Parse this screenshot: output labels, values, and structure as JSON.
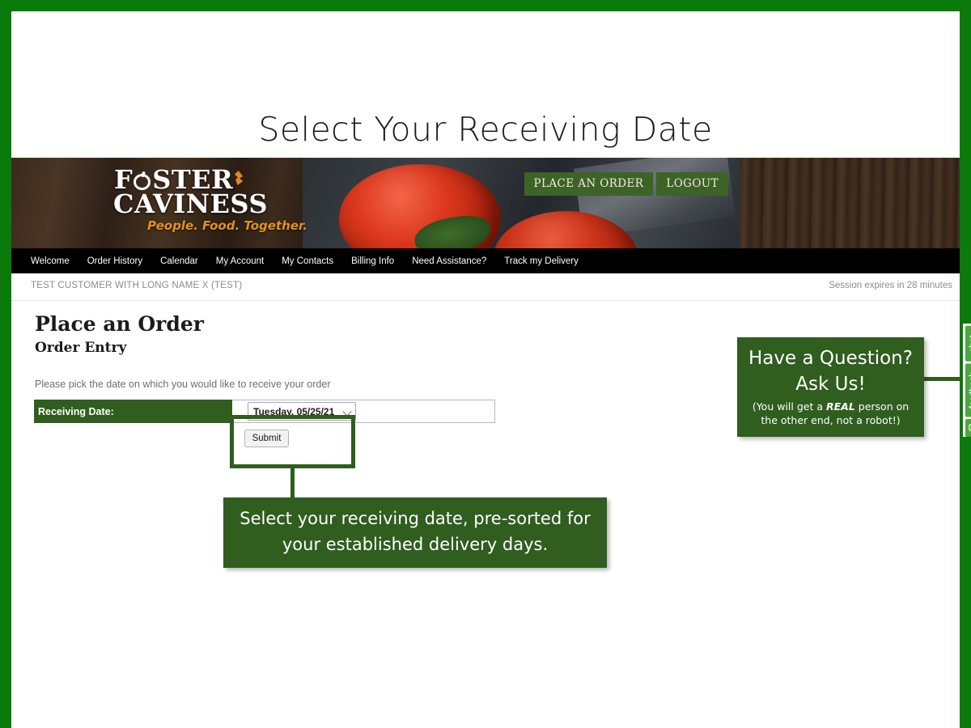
{
  "slide": {
    "title": "Select Your Receiving Date",
    "border_color": "#0a7a0a"
  },
  "header": {
    "logo": {
      "line1": "FOSTER",
      "line2": "CAVINESS",
      "tagline": "People. Food. Together.",
      "apple_icon": "apple-icon",
      "sprout_icon": "sprout-icon"
    },
    "actions": [
      {
        "label": "PLACE AN ORDER",
        "name": "place-an-order-button"
      },
      {
        "label": "LOGOUT",
        "name": "logout-button"
      }
    ]
  },
  "nav": {
    "items": [
      "Welcome",
      "Order History",
      "Calendar",
      "My Account",
      "My Contacts",
      "Billing Info",
      "Need Assistance?",
      "Track my Delivery"
    ]
  },
  "customer_strip": {
    "customer_name": "TEST CUSTOMER WITH LONG NAME X (TEST)",
    "session_expiry": "Session expires in 28 minutes"
  },
  "page": {
    "title": "Place an Order",
    "subtitle": "Order Entry",
    "instruction": "Please pick the date on which you would like to receive your order",
    "form": {
      "date_label": "Receiving Date:",
      "selected_date": "Tuesday, 05/25/21",
      "submit_label": "Submit"
    }
  },
  "annotations": {
    "bottom_callout": "Select your receiving date, pre-sorted for your established delivery days.",
    "right_callout": {
      "line1": "Have a Question?",
      "line2": "Ask Us!",
      "note_before": "(You will get a ",
      "note_emphasis": "REAL",
      "note_after": " person on the other end, not a robot!)"
    },
    "accent_color": "#2f5e1f"
  },
  "side_tabs": {
    "chat_label": "chat",
    "feedback_label": "feedback",
    "icon": "comment-icon",
    "tab_color": "#4aa83c"
  }
}
